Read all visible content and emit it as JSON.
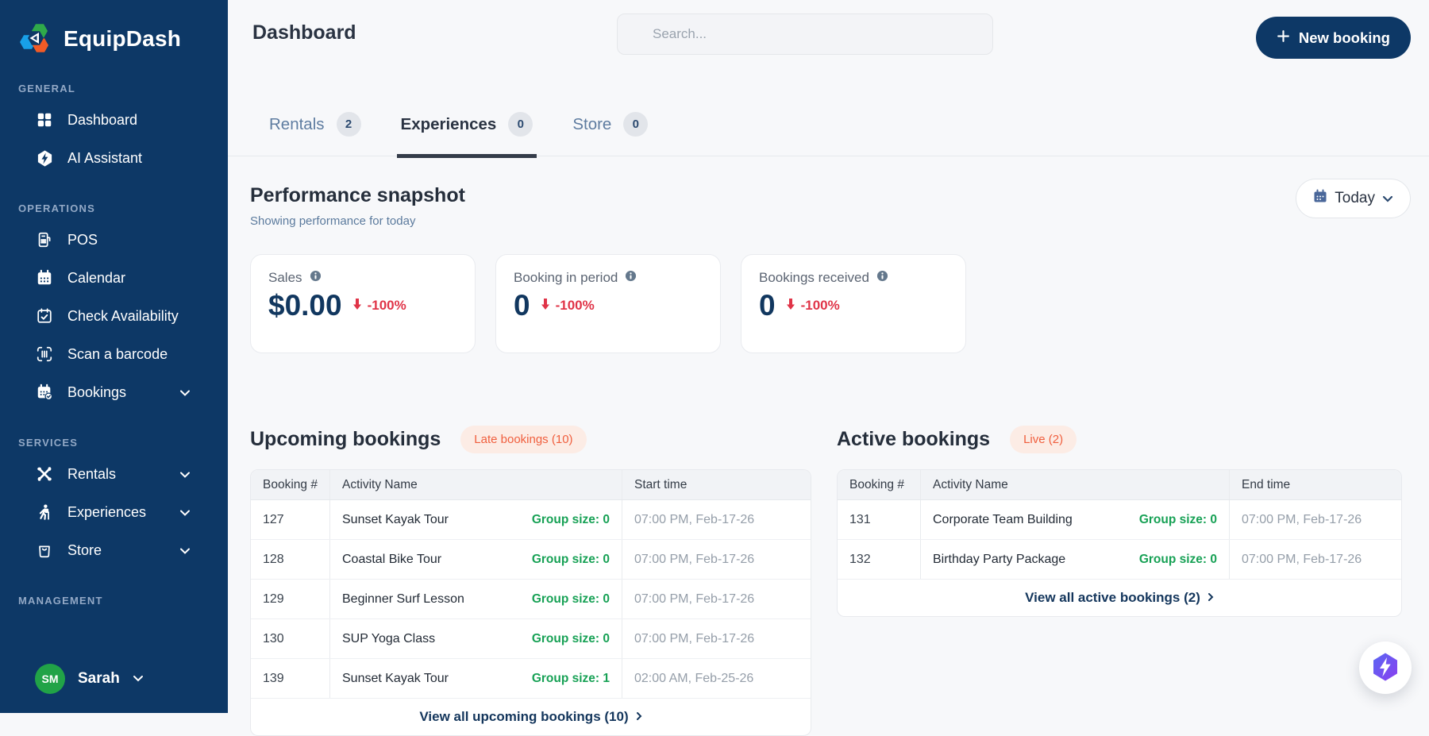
{
  "brand": {
    "name": "EquipDash"
  },
  "sidebar": {
    "sections": [
      {
        "label": "GENERAL",
        "items": [
          {
            "label": "Dashboard"
          },
          {
            "label": "AI Assistant"
          }
        ]
      },
      {
        "label": "OPERATIONS",
        "items": [
          {
            "label": "POS"
          },
          {
            "label": "Calendar"
          },
          {
            "label": "Check Availability"
          },
          {
            "label": "Scan a barcode"
          },
          {
            "label": "Bookings"
          }
        ]
      },
      {
        "label": "SERVICES",
        "items": [
          {
            "label": "Rentals"
          },
          {
            "label": "Experiences"
          },
          {
            "label": "Store"
          }
        ]
      },
      {
        "label": "MANAGEMENT",
        "items": []
      }
    ],
    "user": {
      "initials": "SM",
      "name": "Sarah"
    }
  },
  "header": {
    "title": "Dashboard",
    "search_placeholder": "Search...",
    "new_booking_label": "New booking"
  },
  "tabs": [
    {
      "label": "Rentals",
      "count": "2"
    },
    {
      "label": "Experiences",
      "count": "0"
    },
    {
      "label": "Store",
      "count": "0"
    }
  ],
  "performance": {
    "title": "Performance snapshot",
    "subtitle": "Showing performance for today",
    "period_button": "Today",
    "cards": [
      {
        "label": "Sales",
        "value": "$0.00",
        "delta": "-100%"
      },
      {
        "label": "Booking in period",
        "value": "0",
        "delta": "-100%"
      },
      {
        "label": "Bookings received",
        "value": "0",
        "delta": "-100%"
      }
    ]
  },
  "upcoming": {
    "title": "Upcoming bookings",
    "badge": "Late bookings (10)",
    "columns": [
      "Booking #",
      "Activity Name",
      "Start time"
    ],
    "rows": [
      {
        "id": "127",
        "activity": "Sunset Kayak Tour",
        "group": "Group size: 0",
        "time": "07:00 PM, Feb-17-26"
      },
      {
        "id": "128",
        "activity": "Coastal Bike Tour",
        "group": "Group size: 0",
        "time": "07:00 PM, Feb-17-26"
      },
      {
        "id": "129",
        "activity": "Beginner Surf Lesson",
        "group": "Group size: 0",
        "time": "07:00 PM, Feb-17-26"
      },
      {
        "id": "130",
        "activity": "SUP Yoga Class",
        "group": "Group size: 0",
        "time": "07:00 PM, Feb-17-26"
      },
      {
        "id": "139",
        "activity": "Sunset Kayak Tour",
        "group": "Group size: 1",
        "time": "02:00 AM, Feb-25-26"
      }
    ],
    "view_all": "View all upcoming bookings (10)"
  },
  "active": {
    "title": "Active bookings",
    "badge": "Live (2)",
    "columns": [
      "Booking #",
      "Activity Name",
      "End time"
    ],
    "rows": [
      {
        "id": "131",
        "activity": "Corporate Team Building",
        "group": "Group size: 0",
        "time": "07:00 PM, Feb-17-26"
      },
      {
        "id": "132",
        "activity": "Birthday Party Package",
        "group": "Group size: 0",
        "time": "07:00 PM, Feb-17-26"
      }
    ],
    "view_all": "View all active bookings (2)"
  },
  "colors": {
    "sidebar_navy": "#0d3866",
    "value_navy": "#11375f",
    "delta_red": "#e03448",
    "group_green": "#17a155",
    "late_badge_orange": "#f05f3e",
    "late_badge_bg": "#fcece5",
    "avatar_green": "#21a347",
    "fab_purple_start": "#5a67f2",
    "fab_purple_end": "#8a3ff0"
  }
}
